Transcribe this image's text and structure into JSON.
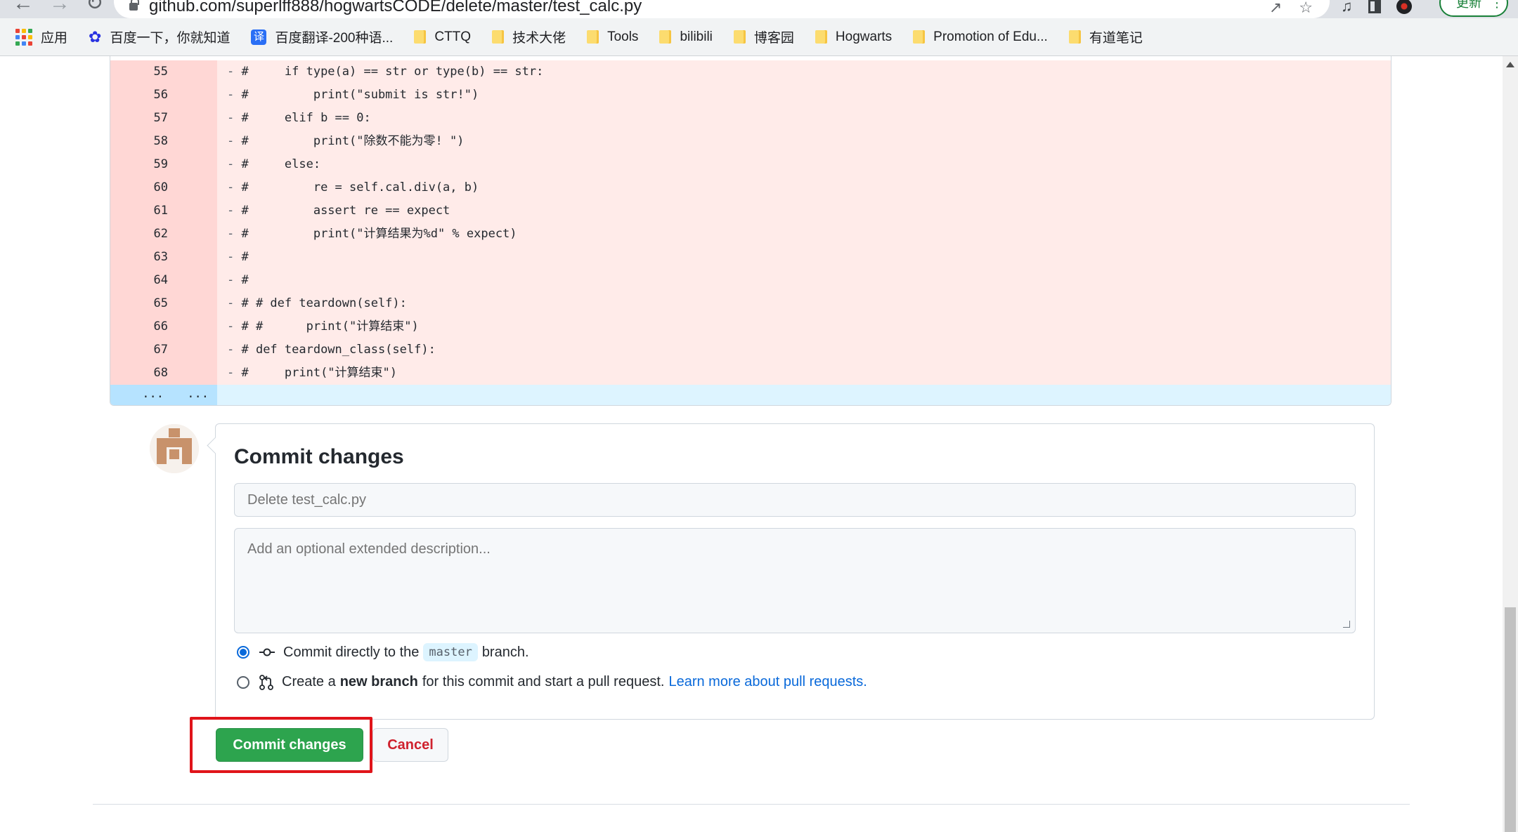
{
  "browser": {
    "url": "github.com/superlff888/hogwartsCODE/delete/master/test_calc.py",
    "update_label": "更新",
    "bookmarks": [
      {
        "label": "应用",
        "icon": "apps-icon"
      },
      {
        "label": "百度一下，你就知道",
        "icon": "baidu-paw-icon"
      },
      {
        "label": "百度翻译-200种语...",
        "icon": "baidu-translate-icon"
      },
      {
        "label": "CTTQ",
        "icon": "folder-icon"
      },
      {
        "label": "技术大佬",
        "icon": "folder-icon"
      },
      {
        "label": "Tools",
        "icon": "folder-icon"
      },
      {
        "label": "bilibili",
        "icon": "folder-icon"
      },
      {
        "label": "博客园",
        "icon": "folder-icon"
      },
      {
        "label": "Hogwarts",
        "icon": "folder-icon"
      },
      {
        "label": "Promotion of Edu...",
        "icon": "folder-icon"
      },
      {
        "label": "有道笔记",
        "icon": "folder-icon"
      }
    ]
  },
  "diff": {
    "lines": [
      {
        "num": "55",
        "marker": "- ",
        "text": "#     if type(a) == str or type(b) == str:"
      },
      {
        "num": "56",
        "marker": "- ",
        "text": "#         print(\"submit is str!\")"
      },
      {
        "num": "57",
        "marker": "- ",
        "text": "#     elif b == 0:"
      },
      {
        "num": "58",
        "marker": "- ",
        "text": "#         print(\"除数不能为零! \")"
      },
      {
        "num": "59",
        "marker": "- ",
        "text": "#     else:"
      },
      {
        "num": "60",
        "marker": "- ",
        "text": "#         re = self.cal.div(a, b)"
      },
      {
        "num": "61",
        "marker": "- ",
        "text": "#         assert re == expect"
      },
      {
        "num": "62",
        "marker": "- ",
        "text": "#         print(\"计算结果为%d\" % expect)"
      },
      {
        "num": "63",
        "marker": "- ",
        "text": "#"
      },
      {
        "num": "64",
        "marker": "- ",
        "text": "#"
      },
      {
        "num": "65",
        "marker": "- ",
        "text": "# # def teardown(self):"
      },
      {
        "num": "66",
        "marker": "- ",
        "text": "# #      print(\"计算结束\")"
      },
      {
        "num": "67",
        "marker": "- ",
        "text": "# def teardown_class(self):"
      },
      {
        "num": "68",
        "marker": "- ",
        "text": "#     print(\"计算结束\")"
      }
    ],
    "expand_left": "...",
    "expand_right": "..."
  },
  "commit": {
    "title": "Commit changes",
    "summary_placeholder": "Delete test_calc.py",
    "description_placeholder": "Add an optional extended description...",
    "option_direct": {
      "prefix": "Commit directly to the",
      "branch": "master",
      "suffix": "branch.",
      "checked": true
    },
    "option_new_branch": {
      "prefix": "Create a",
      "bold": "new branch",
      "suffix": "for this commit and start a pull request.",
      "link": "Learn more about pull requests.",
      "checked": false
    },
    "commit_button": "Commit changes",
    "cancel_button": "Cancel"
  },
  "colors": {
    "deleted_line": "#ffebe9",
    "deleted_num": "#ffd7d5",
    "commit_green": "#2da44e",
    "highlight_red": "#e0141a",
    "link_blue": "#0969da"
  }
}
